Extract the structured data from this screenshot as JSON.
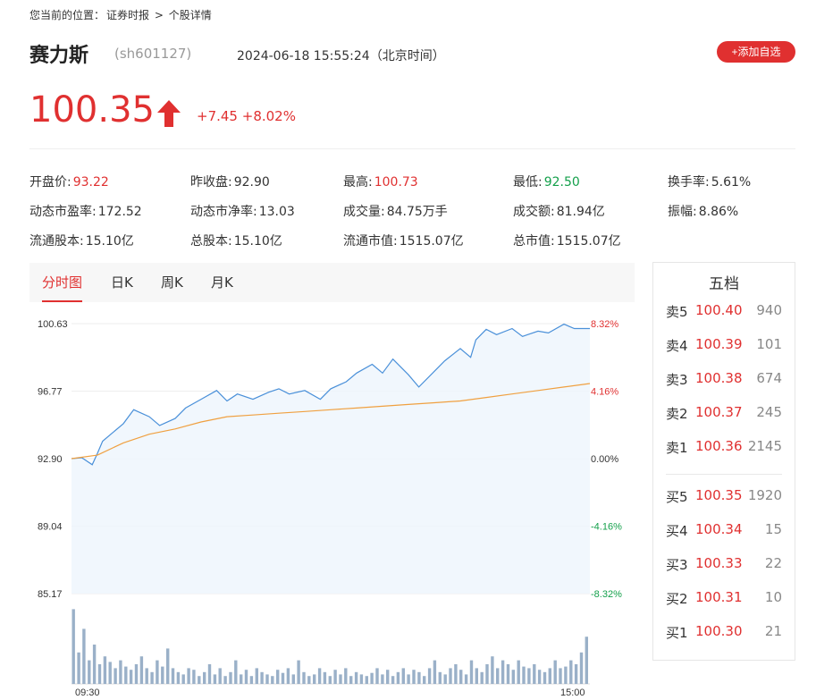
{
  "breadcrumb": {
    "prefix": "您当前的位置：",
    "home": "证券时报",
    "sep": " > ",
    "current": "个股详情"
  },
  "stock": {
    "name": "赛力斯",
    "code": "(sh601127)",
    "datetime": "2024-06-18 15:55:24（北京时间）",
    "add_label": "+添加自选"
  },
  "quote": {
    "price": "100.35",
    "change": "+7.45",
    "change_pct": "+8.02%"
  },
  "stats": [
    {
      "label": "开盘价:",
      "value": "93.22",
      "color": "red"
    },
    {
      "label": "昨收盘:",
      "value": "92.90",
      "color": ""
    },
    {
      "label": "最高:",
      "value": "100.73",
      "color": "red"
    },
    {
      "label": "最低:",
      "value": "92.50",
      "color": "green"
    },
    {
      "label": "换手率:",
      "value": "5.61%",
      "color": ""
    },
    {
      "label": "动态市盈率:",
      "value": "172.52",
      "color": ""
    },
    {
      "label": "动态市净率:",
      "value": "13.03",
      "color": ""
    },
    {
      "label": "成交量:",
      "value": "84.75万手",
      "color": ""
    },
    {
      "label": "成交额:",
      "value": "81.94亿",
      "color": ""
    },
    {
      "label": "振幅:",
      "value": "8.86%",
      "color": ""
    },
    {
      "label": "流通股本:",
      "value": "15.10亿",
      "color": ""
    },
    {
      "label": "总股本:",
      "value": "15.10亿",
      "color": ""
    },
    {
      "label": "流通市值:",
      "value": "1515.07亿",
      "color": ""
    },
    {
      "label": "总市值:",
      "value": "1515.07亿",
      "color": ""
    }
  ],
  "tabs": [
    "分时图",
    "日K",
    "周K",
    "月K"
  ],
  "colors": {
    "up": "#e03030",
    "down": "#14a04b",
    "price_line": "#4a90d9",
    "avg_line": "#f0a040",
    "volume": "#9ab0c8"
  },
  "chart_data": {
    "type": "line",
    "y_ticks_left": [
      "100.63",
      "96.77",
      "92.90",
      "89.04",
      "85.17"
    ],
    "y_ticks_right": [
      "8.32%",
      "4.16%",
      "0.00%",
      "-4.16%",
      "-8.32%"
    ],
    "x_ticks": [
      "09:30",
      "15:00"
    ],
    "ylim": [
      85.17,
      100.63
    ],
    "prev_close": 92.9,
    "series": [
      {
        "x": [
          0,
          0.02,
          0.04,
          0.05,
          0.06,
          0.08,
          0.1,
          0.12,
          0.15,
          0.17,
          0.2,
          0.22,
          0.25,
          0.28,
          0.3,
          0.32,
          0.35,
          0.38,
          0.4,
          0.42,
          0.45,
          0.48,
          0.5,
          0.53,
          0.55,
          0.58,
          0.6,
          0.62,
          0.65,
          0.67,
          0.7,
          0.72,
          0.75,
          0.77,
          0.78,
          0.8,
          0.82,
          0.85,
          0.87,
          0.88,
          0.9,
          0.92,
          0.95,
          0.97,
          1.0
        ],
        "values": [
          92.9,
          92.95,
          92.55,
          93.2,
          93.9,
          94.4,
          94.9,
          95.7,
          95.3,
          94.8,
          95.2,
          95.8,
          96.3,
          96.8,
          96.2,
          96.6,
          96.3,
          96.7,
          96.9,
          96.6,
          96.8,
          96.3,
          96.9,
          97.3,
          97.8,
          98.3,
          97.8,
          98.6,
          97.7,
          97.0,
          97.9,
          98.5,
          99.2,
          98.7,
          99.7,
          100.3,
          100.0,
          100.35,
          99.9,
          100.0,
          100.2,
          100.1,
          100.6,
          100.35,
          100.35
        ]
      },
      {
        "x": [
          0,
          0.05,
          0.1,
          0.15,
          0.2,
          0.25,
          0.3,
          0.35,
          0.4,
          0.45,
          0.5,
          0.55,
          0.6,
          0.65,
          0.7,
          0.75,
          0.8,
          0.85,
          0.9,
          0.95,
          1.0
        ],
        "values": [
          92.9,
          93.1,
          93.8,
          94.3,
          94.6,
          95.0,
          95.3,
          95.4,
          95.5,
          95.6,
          95.7,
          95.8,
          95.9,
          96.0,
          96.1,
          96.2,
          96.4,
          96.6,
          96.8,
          97.0,
          97.2
        ]
      }
    ],
    "volume_fraction": [
      0.95,
      0.4,
      0.7,
      0.3,
      0.5,
      0.25,
      0.35,
      0.28,
      0.2,
      0.3,
      0.22,
      0.18,
      0.25,
      0.35,
      0.2,
      0.15,
      0.3,
      0.22,
      0.45,
      0.2,
      0.15,
      0.12,
      0.2,
      0.18,
      0.1,
      0.15,
      0.25,
      0.12,
      0.2,
      0.1,
      0.15,
      0.3,
      0.12,
      0.18,
      0.1,
      0.2,
      0.15,
      0.12,
      0.1,
      0.18,
      0.14,
      0.2,
      0.12,
      0.3,
      0.15,
      0.1,
      0.12,
      0.2,
      0.15,
      0.1,
      0.18,
      0.12,
      0.2,
      0.1,
      0.15,
      0.12,
      0.1,
      0.14,
      0.2,
      0.12,
      0.18,
      0.1,
      0.15,
      0.2,
      0.12,
      0.18,
      0.15,
      0.1,
      0.2,
      0.3,
      0.15,
      0.12,
      0.2,
      0.25,
      0.18,
      0.12,
      0.3,
      0.2,
      0.15,
      0.25,
      0.35,
      0.2,
      0.3,
      0.25,
      0.18,
      0.3,
      0.22,
      0.2,
      0.25,
      0.18,
      0.15,
      0.2,
      0.3,
      0.2,
      0.22,
      0.3,
      0.25,
      0.4,
      0.6
    ]
  },
  "orderbook": {
    "title": "五档",
    "asks": [
      {
        "label": "卖5",
        "price": "100.40",
        "qty": "940"
      },
      {
        "label": "卖4",
        "price": "100.39",
        "qty": "101"
      },
      {
        "label": "卖3",
        "price": "100.38",
        "qty": "674"
      },
      {
        "label": "卖2",
        "price": "100.37",
        "qty": "245"
      },
      {
        "label": "卖1",
        "price": "100.36",
        "qty": "2145"
      }
    ],
    "bids": [
      {
        "label": "买5",
        "price": "100.35",
        "qty": "1920"
      },
      {
        "label": "买4",
        "price": "100.34",
        "qty": "15"
      },
      {
        "label": "买3",
        "price": "100.33",
        "qty": "22"
      },
      {
        "label": "买2",
        "price": "100.31",
        "qty": "10"
      },
      {
        "label": "买1",
        "price": "100.30",
        "qty": "21"
      }
    ]
  }
}
